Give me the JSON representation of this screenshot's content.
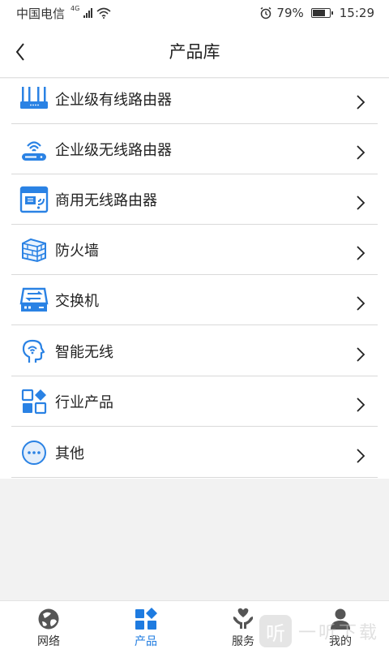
{
  "status_bar": {
    "carrier": "中国电信",
    "network": "4G",
    "battery": "79%",
    "battery_level": 0.79,
    "time": "15:29"
  },
  "header": {
    "title": "产品库",
    "back_icon": "chevron-left-icon"
  },
  "products": [
    {
      "label": "企业级有线路由器",
      "icon": "wired-router-icon"
    },
    {
      "label": "企业级无线路由器",
      "icon": "wireless-router-icon"
    },
    {
      "label": "商用无线路由器",
      "icon": "commercial-router-icon"
    },
    {
      "label": "防火墙",
      "icon": "firewall-icon"
    },
    {
      "label": "交换机",
      "icon": "switch-icon"
    },
    {
      "label": "智能无线",
      "icon": "smart-wireless-icon"
    },
    {
      "label": "行业产品",
      "icon": "industry-icon"
    },
    {
      "label": "其他",
      "icon": "more-icon"
    }
  ],
  "tabs": [
    {
      "label": "网络",
      "icon": "network-icon",
      "active": false
    },
    {
      "label": "产品",
      "icon": "products-icon",
      "active": true
    },
    {
      "label": "服务",
      "icon": "service-icon",
      "active": false
    },
    {
      "label": "我的",
      "icon": "profile-icon",
      "active": false
    }
  ],
  "watermark": {
    "badge": "听",
    "text": "一听下载"
  },
  "colors": {
    "accent": "#1e7be0",
    "icon_blue": "#2a82e4",
    "divider": "#d9d9d9",
    "background": "#f2f2f2"
  }
}
